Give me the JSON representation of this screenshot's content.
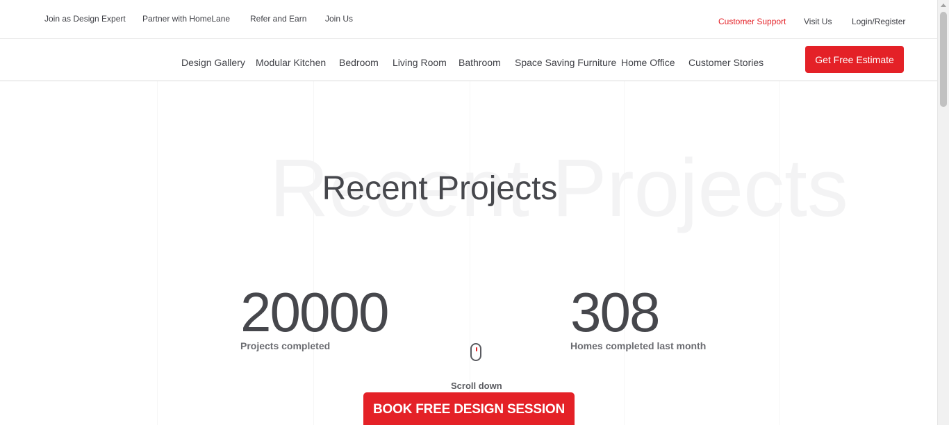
{
  "utility_nav": {
    "join_expert": "Join as Design Expert",
    "partner": "Partner with HomeLane",
    "refer": "Refer and Earn",
    "join_us": "Join Us",
    "customer_support": "Customer Support",
    "visit_us": "Visit Us",
    "login": "Login/Register"
  },
  "main_nav": {
    "items": [
      "Design Gallery",
      "Modular Kitchen",
      "Bedroom",
      "Living Room",
      "Bathroom",
      "Space Saving Furniture",
      "Home Office",
      "Customer Stories"
    ],
    "estimate_button": "Get Free Estimate"
  },
  "hero": {
    "watermark": "Recent Projects",
    "title": "Recent Projects",
    "stats": [
      {
        "value": "20000",
        "label": "Projects completed"
      },
      {
        "value": "308",
        "label": "Homes completed last month"
      }
    ],
    "scroll_text": "Scroll down",
    "book_button": "BOOK FREE DESIGN SESSION"
  },
  "colors": {
    "accent": "#e42127",
    "text": "#3f4046",
    "watermark": "#f3f3f4"
  },
  "icons": {
    "scroll": "mouse-icon"
  }
}
